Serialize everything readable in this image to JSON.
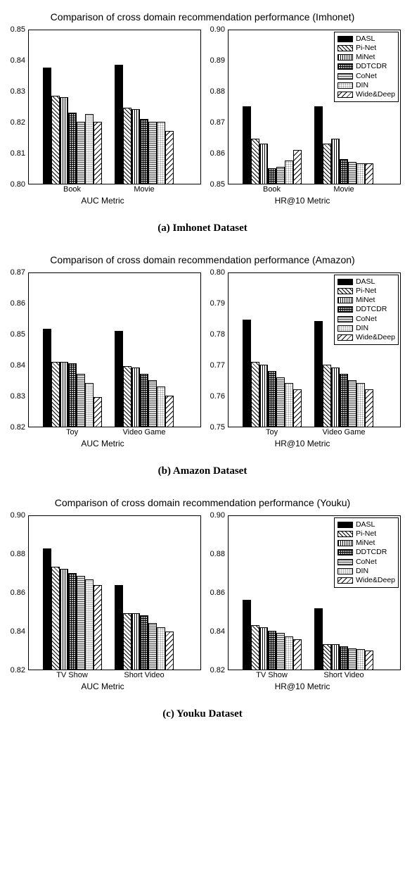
{
  "legend_labels": [
    "DASL",
    "Pi-Net",
    "MiNet",
    "DDTCDR",
    "CoNet",
    "DIN",
    "Wide&Deep"
  ],
  "patterns": [
    "pat-solid",
    "pat-diag1",
    "pat-vert",
    "pat-cross",
    "pat-hatch",
    "pat-dots",
    "pat-diag2"
  ],
  "figures": [
    {
      "title": "Comparison of cross domain recommendation performance (Imhonet)",
      "caption": "(a) Imhonet Dataset",
      "panels": [
        {
          "xlabel": "AUC Metric",
          "ymin": 0.8,
          "ymax": 0.85,
          "yticks": [
            0.8,
            0.81,
            0.82,
            0.83,
            0.84,
            0.85
          ],
          "legend": false,
          "groups": [
            {
              "label": "Book",
              "values": [
                0.8375,
                0.8285,
                0.828,
                0.823,
                0.82,
                0.8225,
                0.82
              ]
            },
            {
              "label": "Movie",
              "values": [
                0.8385,
                0.8245,
                0.824,
                0.821,
                0.82,
                0.82,
                0.817
              ]
            }
          ]
        },
        {
          "xlabel": "HR@10 Metric",
          "ymin": 0.85,
          "ymax": 0.9,
          "yticks": [
            0.85,
            0.86,
            0.87,
            0.88,
            0.89,
            0.9
          ],
          "legend": true,
          "groups": [
            {
              "label": "Book",
              "values": [
                0.875,
                0.8645,
                0.863,
                0.855,
                0.8555,
                0.8575,
                0.861
              ]
            },
            {
              "label": "Movie",
              "values": [
                0.875,
                0.863,
                0.8645,
                0.858,
                0.857,
                0.8565,
                0.8565
              ]
            }
          ]
        }
      ]
    },
    {
      "title": "Comparison of cross domain recommendation performance (Amazon)",
      "caption": "(b) Amazon Dataset",
      "panels": [
        {
          "xlabel": "AUC Metric",
          "ymin": 0.82,
          "ymax": 0.87,
          "yticks": [
            0.82,
            0.83,
            0.84,
            0.85,
            0.86,
            0.87
          ],
          "legend": false,
          "groups": [
            {
              "label": "Toy",
              "values": [
                0.8515,
                0.841,
                0.841,
                0.8405,
                0.837,
                0.834,
                0.8295
              ]
            },
            {
              "label": "Video Game",
              "values": [
                0.851,
                0.8395,
                0.839,
                0.837,
                0.835,
                0.833,
                0.83
              ]
            }
          ]
        },
        {
          "xlabel": "HR@10 Metric",
          "ymin": 0.75,
          "ymax": 0.8,
          "yticks": [
            0.75,
            0.76,
            0.77,
            0.78,
            0.79,
            0.8
          ],
          "legend": true,
          "groups": [
            {
              "label": "Toy",
              "values": [
                0.7845,
                0.771,
                0.77,
                0.768,
                0.766,
                0.764,
                0.762
              ]
            },
            {
              "label": "Video Game",
              "values": [
                0.784,
                0.77,
                0.769,
                0.767,
                0.765,
                0.764,
                0.762
              ]
            }
          ]
        }
      ]
    },
    {
      "title": "Comparison of cross domain recommendation performance (Youku)",
      "caption": "(c) Youku Dataset",
      "panels": [
        {
          "xlabel": "AUC Metric",
          "ymin": 0.82,
          "ymax": 0.9,
          "yticks": [
            0.82,
            0.84,
            0.86,
            0.88,
            0.9
          ],
          "legend": false,
          "groups": [
            {
              "label": "TV Show",
              "values": [
                0.8825,
                0.873,
                0.872,
                0.87,
                0.8685,
                0.8665,
                0.8635
              ]
            },
            {
              "label": "Short Video",
              "values": [
                0.8635,
                0.849,
                0.849,
                0.848,
                0.844,
                0.842,
                0.8395
              ]
            }
          ]
        },
        {
          "xlabel": "HR@10 Metric",
          "ymin": 0.82,
          "ymax": 0.9,
          "yticks": [
            0.82,
            0.84,
            0.86,
            0.88,
            0.9
          ],
          "legend": true,
          "groups": [
            {
              "label": "TV Show",
              "values": [
                0.856,
                0.843,
                0.842,
                0.84,
                0.839,
                0.837,
                0.8355
              ]
            },
            {
              "label": "Short Video",
              "values": [
                0.8515,
                0.833,
                0.833,
                0.832,
                0.831,
                0.8305,
                0.83
              ]
            }
          ]
        }
      ]
    }
  ],
  "chart_data": [
    {
      "type": "bar",
      "title": "Comparison of cross domain recommendation performance (Imhonet)",
      "xlabel": "AUC Metric",
      "ylabel": "",
      "ylim": [
        0.8,
        0.85
      ],
      "categories": [
        "Book",
        "Movie"
      ],
      "series": [
        {
          "name": "DASL",
          "values": [
            0.8375,
            0.8385
          ]
        },
        {
          "name": "Pi-Net",
          "values": [
            0.8285,
            0.8245
          ]
        },
        {
          "name": "MiNet",
          "values": [
            0.828,
            0.824
          ]
        },
        {
          "name": "DDTCDR",
          "values": [
            0.823,
            0.821
          ]
        },
        {
          "name": "CoNet",
          "values": [
            0.82,
            0.82
          ]
        },
        {
          "name": "DIN",
          "values": [
            0.8225,
            0.82
          ]
        },
        {
          "name": "Wide&Deep",
          "values": [
            0.82,
            0.817
          ]
        }
      ]
    },
    {
      "type": "bar",
      "title": "Comparison of cross domain recommendation performance (Imhonet)",
      "xlabel": "HR@10 Metric",
      "ylabel": "",
      "ylim": [
        0.85,
        0.9
      ],
      "categories": [
        "Book",
        "Movie"
      ],
      "series": [
        {
          "name": "DASL",
          "values": [
            0.875,
            0.875
          ]
        },
        {
          "name": "Pi-Net",
          "values": [
            0.8645,
            0.863
          ]
        },
        {
          "name": "MiNet",
          "values": [
            0.863,
            0.8645
          ]
        },
        {
          "name": "DDTCDR",
          "values": [
            0.855,
            0.858
          ]
        },
        {
          "name": "CoNet",
          "values": [
            0.8555,
            0.857
          ]
        },
        {
          "name": "DIN",
          "values": [
            0.8575,
            0.8565
          ]
        },
        {
          "name": "Wide&Deep",
          "values": [
            0.861,
            0.8565
          ]
        }
      ]
    },
    {
      "type": "bar",
      "title": "Comparison of cross domain recommendation performance (Amazon)",
      "xlabel": "AUC Metric",
      "ylabel": "",
      "ylim": [
        0.82,
        0.87
      ],
      "categories": [
        "Toy",
        "Video Game"
      ],
      "series": [
        {
          "name": "DASL",
          "values": [
            0.8515,
            0.851
          ]
        },
        {
          "name": "Pi-Net",
          "values": [
            0.841,
            0.8395
          ]
        },
        {
          "name": "MiNet",
          "values": [
            0.841,
            0.839
          ]
        },
        {
          "name": "DDTCDR",
          "values": [
            0.8405,
            0.837
          ]
        },
        {
          "name": "CoNet",
          "values": [
            0.837,
            0.835
          ]
        },
        {
          "name": "DIN",
          "values": [
            0.834,
            0.833
          ]
        },
        {
          "name": "Wide&Deep",
          "values": [
            0.8295,
            0.83
          ]
        }
      ]
    },
    {
      "type": "bar",
      "title": "Comparison of cross domain recommendation performance (Amazon)",
      "xlabel": "HR@10 Metric",
      "ylabel": "",
      "ylim": [
        0.75,
        0.8
      ],
      "categories": [
        "Toy",
        "Video Game"
      ],
      "series": [
        {
          "name": "DASL",
          "values": [
            0.7845,
            0.784
          ]
        },
        {
          "name": "Pi-Net",
          "values": [
            0.771,
            0.77
          ]
        },
        {
          "name": "MiNet",
          "values": [
            0.77,
            0.769
          ]
        },
        {
          "name": "DDTCDR",
          "values": [
            0.768,
            0.767
          ]
        },
        {
          "name": "CoNet",
          "values": [
            0.766,
            0.765
          ]
        },
        {
          "name": "DIN",
          "values": [
            0.764,
            0.764
          ]
        },
        {
          "name": "Wide&Deep",
          "values": [
            0.762,
            0.762
          ]
        }
      ]
    },
    {
      "type": "bar",
      "title": "Comparison of cross domain recommendation performance (Youku)",
      "xlabel": "AUC Metric",
      "ylabel": "",
      "ylim": [
        0.82,
        0.9
      ],
      "categories": [
        "TV Show",
        "Short Video"
      ],
      "series": [
        {
          "name": "DASL",
          "values": [
            0.8825,
            0.8635
          ]
        },
        {
          "name": "Pi-Net",
          "values": [
            0.873,
            0.849
          ]
        },
        {
          "name": "MiNet",
          "values": [
            0.872,
            0.849
          ]
        },
        {
          "name": "DDTCDR",
          "values": [
            0.87,
            0.848
          ]
        },
        {
          "name": "CoNet",
          "values": [
            0.8685,
            0.844
          ]
        },
        {
          "name": "DIN",
          "values": [
            0.8665,
            0.842
          ]
        },
        {
          "name": "Wide&Deep",
          "values": [
            0.8635,
            0.8395
          ]
        }
      ]
    },
    {
      "type": "bar",
      "title": "Comparison of cross domain recommendation performance (Youku)",
      "xlabel": "HR@10 Metric",
      "ylabel": "",
      "ylim": [
        0.82,
        0.9
      ],
      "categories": [
        "TV Show",
        "Short Video"
      ],
      "series": [
        {
          "name": "DASL",
          "values": [
            0.856,
            0.8515
          ]
        },
        {
          "name": "Pi-Net",
          "values": [
            0.843,
            0.833
          ]
        },
        {
          "name": "MiNet",
          "values": [
            0.842,
            0.833
          ]
        },
        {
          "name": "DDTCDR",
          "values": [
            0.84,
            0.832
          ]
        },
        {
          "name": "CoNet",
          "values": [
            0.839,
            0.831
          ]
        },
        {
          "name": "DIN",
          "values": [
            0.837,
            0.8305
          ]
        },
        {
          "name": "Wide&Deep",
          "values": [
            0.8355,
            0.83
          ]
        }
      ]
    }
  ]
}
